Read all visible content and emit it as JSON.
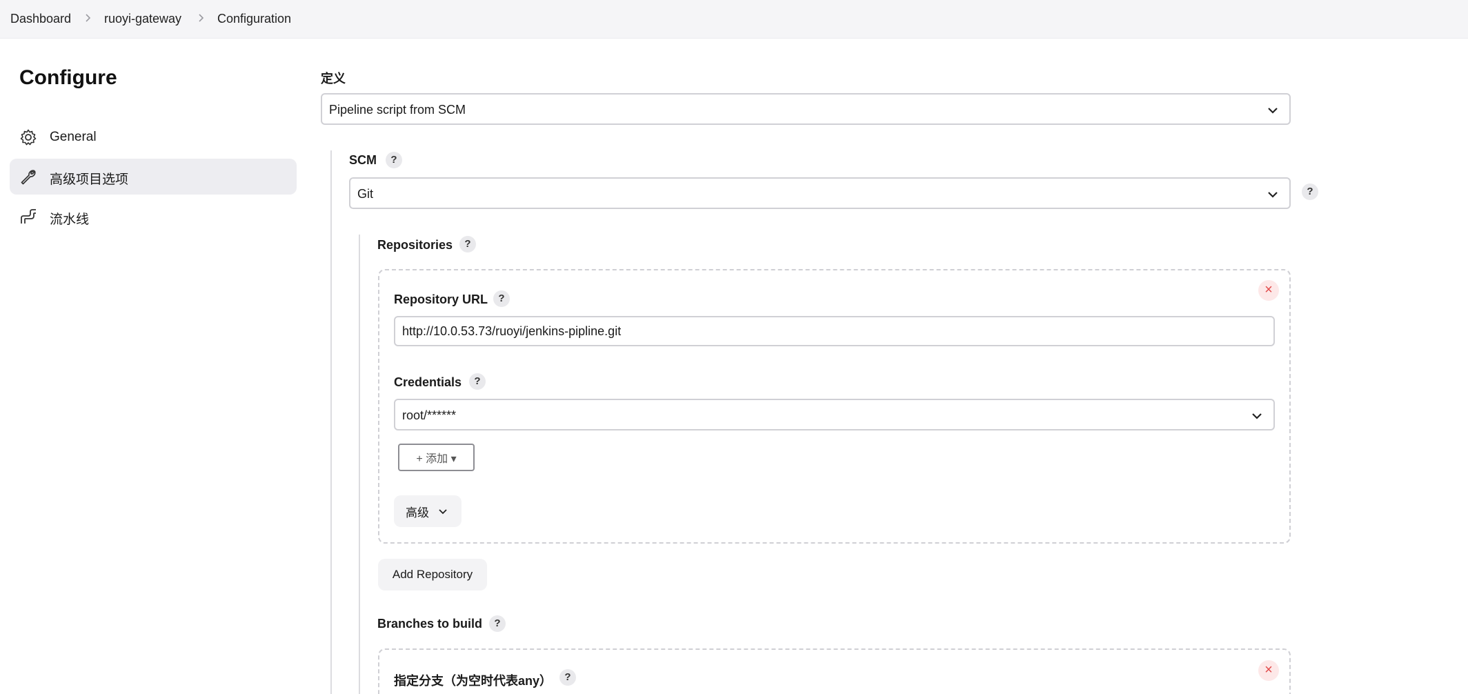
{
  "breadcrumb": {
    "items": [
      "Dashboard",
      "ruoyi-gateway",
      "Configuration"
    ]
  },
  "sidebar": {
    "title": "Configure",
    "items": [
      {
        "label": "General",
        "icon": "gear-icon"
      },
      {
        "label": "高级项目选项",
        "icon": "wrench-icon",
        "active": true
      },
      {
        "label": "流水线",
        "icon": "pipeline-icon"
      }
    ]
  },
  "definition": {
    "label": "定义",
    "value": "Pipeline script from SCM"
  },
  "scm": {
    "label": "SCM",
    "value": "Git"
  },
  "repositories": {
    "label": "Repositories",
    "url_label": "Repository URL",
    "url_value": "http://10.0.53.73/ruoyi/jenkins-pipline.git",
    "credentials_label": "Credentials",
    "credentials_value": "root/******",
    "add_label": "+ 添加 ▾",
    "advanced_label": "高级",
    "add_repository_label": "Add Repository"
  },
  "branches": {
    "label": "Branches to build",
    "specifier_label": "指定分支（为空时代表any）"
  },
  "help_glyph": "?",
  "close_glyph": "×",
  "colors": {
    "topbar_bg": "#f5f5f7",
    "active_item_bg": "#ededf1",
    "close_red": "#e24b4b"
  }
}
